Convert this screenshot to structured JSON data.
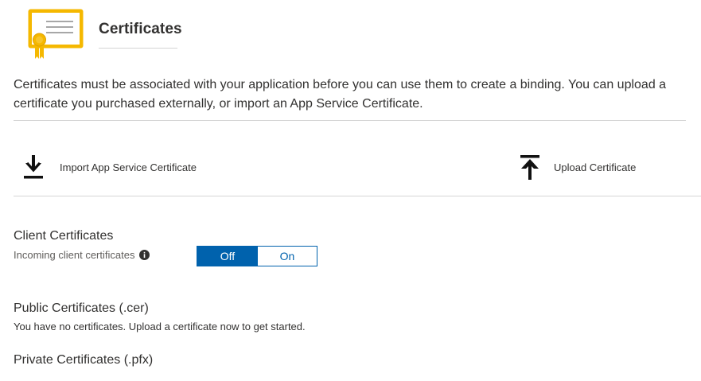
{
  "header": {
    "title": "Certificates",
    "icon": "certificate-icon"
  },
  "description": "Certificates must be associated with your application before you can use them to create a binding. You can upload a certificate you purchased externally, or import an App Service Certificate.",
  "actions": {
    "import_label": "Import App Service Certificate",
    "import_icon": "download-icon",
    "upload_label": "Upload Certificate",
    "upload_icon": "upload-icon"
  },
  "client_certificates": {
    "title": "Client Certificates",
    "subtitle": "Incoming client certificates",
    "info_icon": "info-icon",
    "toggle": {
      "off_label": "Off",
      "on_label": "On",
      "selected": "Off"
    }
  },
  "public_certificates": {
    "title": "Public Certificates (.cer)",
    "message": "You have no certificates. Upload a certificate now to get started."
  },
  "private_certificates": {
    "title": "Private Certificates (.pfx)"
  },
  "colors": {
    "accent": "#0062ad",
    "certificate_gold": "#f5b800",
    "text": "#323130",
    "divider": "#d6d6d6"
  }
}
